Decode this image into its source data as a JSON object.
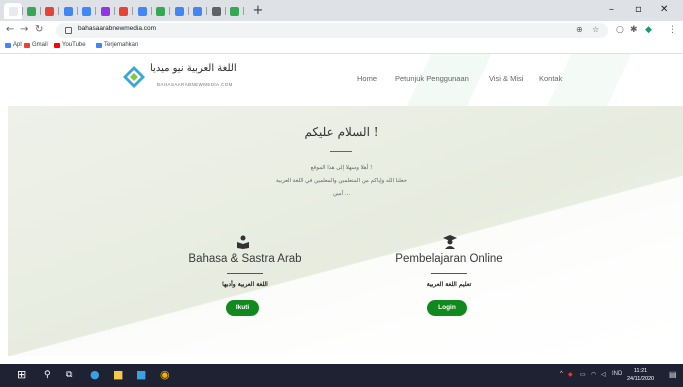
{
  "browser": {
    "url": "bahasaarabnewmedia.com",
    "new_tab": "+",
    "tab_colors": [
      "#e8eaed",
      "#34a853",
      "#e94235",
      "#4285f4",
      "#4285f4",
      "#9334e6",
      "#e94235",
      "#4285f4",
      "#34a853",
      "#4285f4",
      "#4285f4",
      "#5f6368",
      "#34a853"
    ],
    "bookmarks": [
      {
        "label": "Apl",
        "color": "#4285f4"
      },
      {
        "label": "Gmail",
        "color": "#ea4335"
      },
      {
        "label": "YouTube",
        "color": "#ff0000"
      },
      {
        "label": "Terjemahkan",
        "color": "#4285f4"
      }
    ]
  },
  "site": {
    "logo_title": "اللغة العربية نيو ميديا",
    "logo_subtitle": "BAHASAARABNEWMEDIA.COM",
    "nav": [
      "Home",
      "Petunjuk Penggunaan",
      "Visi & Misi",
      "Kontak"
    ],
    "greeting": {
      "title": "السلام عليكم !",
      "lines": [
        "أهلا وسهلا إلى هذا الموقع !",
        "جعلنا الله وإياكم من المتعلمين والمعلمين في اللغة العربية",
        "آمين ..."
      ]
    },
    "cards": [
      {
        "icon": "book-reader-icon",
        "title": "Bahasa & Sastra Arab",
        "arabic": "اللغة العربية وأدبها",
        "button": "Ikuti"
      },
      {
        "icon": "graduate-icon",
        "title": "Pembelajaran Online",
        "arabic": "تعليم اللغة العربية",
        "button": "Login"
      }
    ],
    "accent_color": "#108a1c"
  },
  "taskbar": {
    "time": "11:21",
    "date": "24/11/2020",
    "lang": "IND"
  }
}
